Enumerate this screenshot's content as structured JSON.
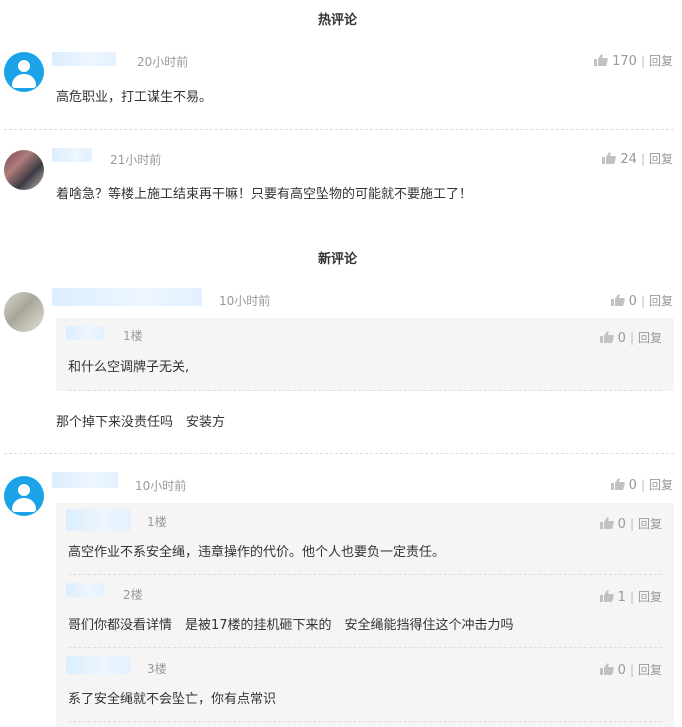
{
  "sections": {
    "hot_title": "热评论",
    "new_title": "新评论"
  },
  "ui": {
    "reply_label": "回复",
    "thumb_icon": "thumbs-up-icon",
    "avatar_icon": "user-avatar-icon",
    "colors": {
      "accent": "#1aa3e8",
      "muted": "#999999",
      "reply_bg": "#f5f5f5"
    }
  },
  "hot": [
    {
      "time": "20小时前",
      "text": "高危职业，打工谋生不易。",
      "likes": "170"
    },
    {
      "time": "21小时前",
      "text": "着啥急？等楼上施工结束再干嘛！只要有高空坠物的可能就不要施工了！",
      "likes": "24"
    }
  ],
  "new": [
    {
      "time": "10小时前",
      "likes": "0",
      "text": "那个掉下来没责任吗　安装方",
      "replies": [
        {
          "floor": "1楼",
          "text": "和什么空调牌子无关,",
          "likes": "0"
        }
      ]
    },
    {
      "time": "10小时前",
      "likes": "0",
      "replies": [
        {
          "floor": "1楼",
          "text": "高空作业不系安全绳，违章操作的代价。他个人也要负一定责任。",
          "likes": "0"
        },
        {
          "floor": "2楼",
          "text": "哥们你都没看详情　是被17楼的挂机砸下来的　安全绳能挡得住这个冲击力吗",
          "likes": "1"
        },
        {
          "floor": "3楼",
          "text": "系了安全绳就不会坠亡，你有点常识",
          "likes": "0"
        }
      ]
    }
  ]
}
